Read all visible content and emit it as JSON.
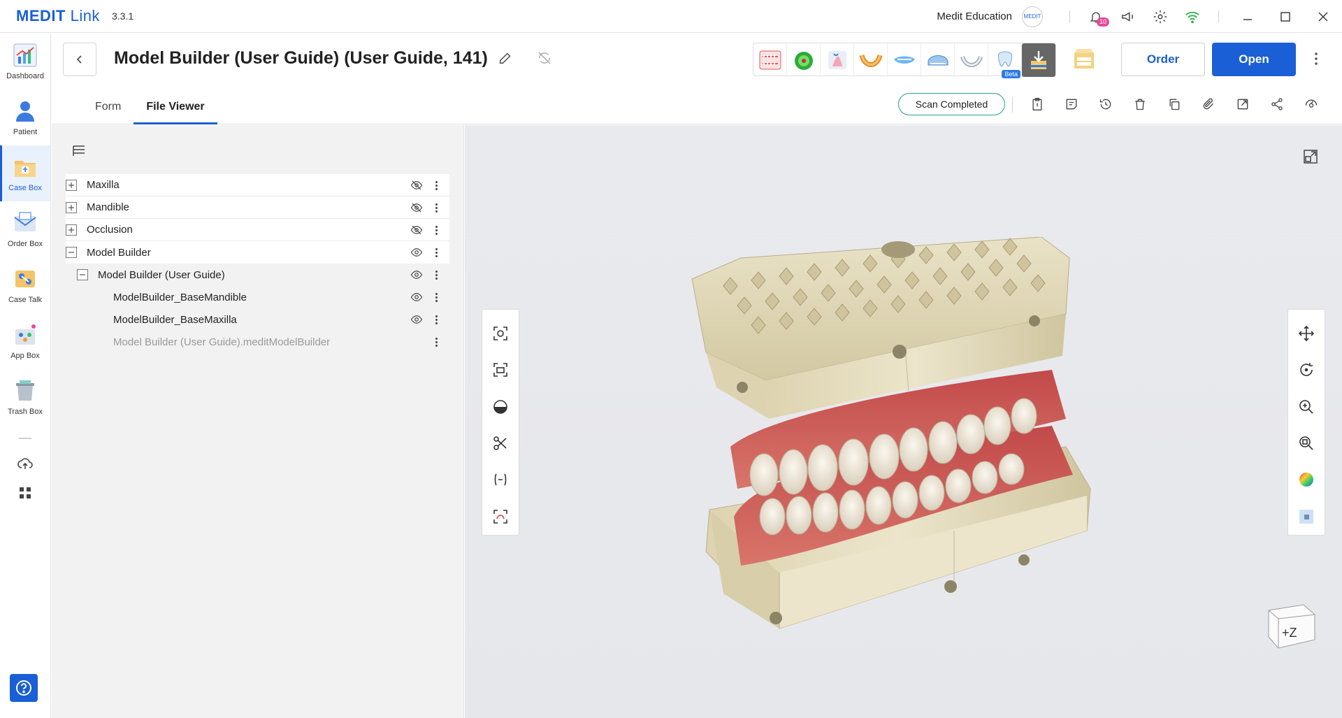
{
  "app": {
    "logo_bold": "MEDIT",
    "logo_thin": "Link",
    "version": "3.3.1"
  },
  "titlebar": {
    "user_name": "Medit Education",
    "user_badge": "MEDIT",
    "notification_count": "10"
  },
  "nav": {
    "items": [
      {
        "label": "Dashboard",
        "icon": "dashboard-icon"
      },
      {
        "label": "Patient",
        "icon": "patient-icon"
      },
      {
        "label": "Case Box",
        "icon": "case-box-icon"
      },
      {
        "label": "Order Box",
        "icon": "order-box-icon"
      },
      {
        "label": "Case Talk",
        "icon": "case-talk-icon"
      },
      {
        "label": "App Box",
        "icon": "app-box-icon"
      },
      {
        "label": "Trash Box",
        "icon": "trash-box-icon"
      }
    ],
    "active": "Case Box"
  },
  "header": {
    "case_title": "Model Builder (User Guide) (User Guide, 141)",
    "order_label": "Order",
    "open_label": "Open",
    "beta_label": "Beta",
    "tabs": [
      {
        "label": "Form"
      },
      {
        "label": "File Viewer"
      }
    ],
    "active_tab": "File Viewer",
    "status": "Scan Completed"
  },
  "tree": {
    "rows": [
      {
        "label": "Maxilla"
      },
      {
        "label": "Mandible"
      },
      {
        "label": "Occlusion"
      },
      {
        "label": "Model Builder"
      },
      {
        "label": "Model Builder (User Guide)"
      },
      {
        "label": "ModelBuilder_BaseMandible"
      },
      {
        "label": "ModelBuilder_BaseMaxilla"
      },
      {
        "label": "Model Builder (User Guide).meditModelBuilder"
      }
    ]
  },
  "viewer": {
    "cube_label": "+Z"
  },
  "colors": {
    "accent": "#1a5fd6",
    "status_border": "#2a9d8f",
    "notification": "#e74a9b"
  }
}
